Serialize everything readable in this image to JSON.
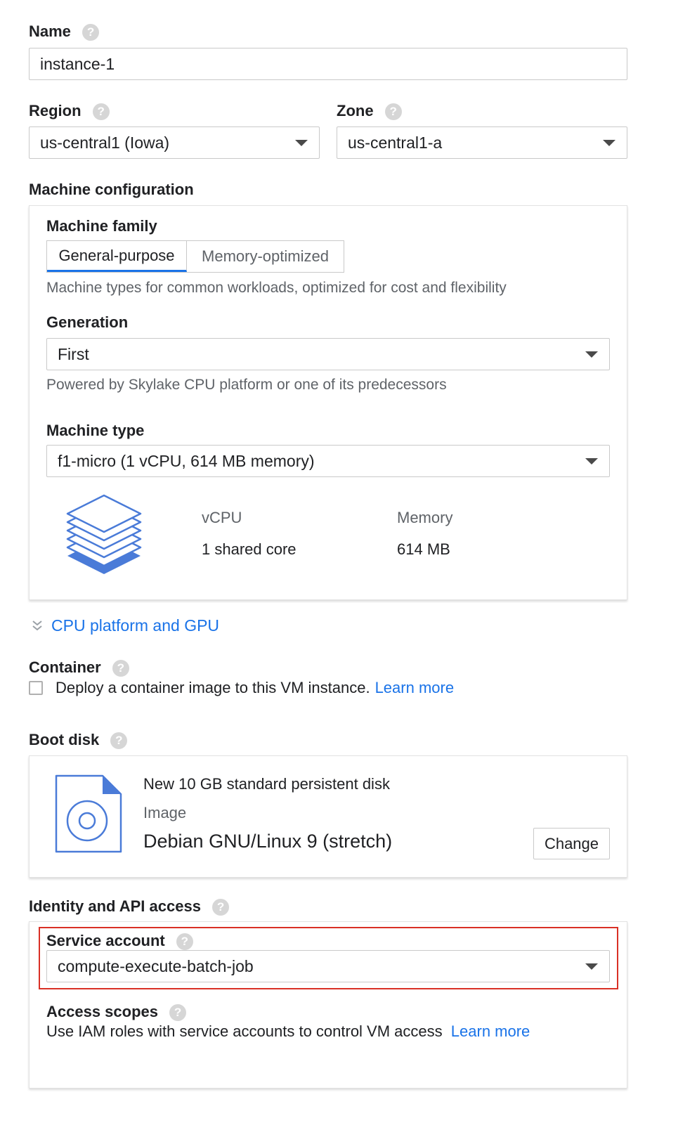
{
  "name": {
    "label": "Name",
    "value": "instance-1"
  },
  "region": {
    "label": "Region",
    "value": "us-central1 (Iowa)"
  },
  "zone": {
    "label": "Zone",
    "value": "us-central1-a"
  },
  "machine_config": {
    "heading": "Machine configuration",
    "family": {
      "label": "Machine family",
      "tabs": [
        "General-purpose",
        "Memory-optimized"
      ],
      "description": "Machine types for common workloads, optimized for cost and flexibility"
    },
    "generation": {
      "label": "Generation",
      "value": "First",
      "description": "Powered by Skylake CPU platform or one of its predecessors"
    },
    "machine_type": {
      "label": "Machine type",
      "value": "f1-micro (1 vCPU, 614 MB memory)"
    },
    "specs": {
      "vcpu_label": "vCPU",
      "vcpu_value": "1 shared core",
      "memory_label": "Memory",
      "memory_value": "614 MB"
    }
  },
  "cpu_gpu_link": "CPU platform and GPU",
  "container": {
    "label": "Container",
    "checkbox_text": "Deploy a container image to this VM instance.",
    "learn_more": "Learn more"
  },
  "boot_disk": {
    "label": "Boot disk",
    "title": "New 10 GB standard persistent disk",
    "image_label": "Image",
    "image_value": "Debian GNU/Linux 9 (stretch)",
    "change_button": "Change"
  },
  "identity": {
    "label": "Identity and API access",
    "service_account": {
      "label": "Service account",
      "value": "compute-execute-batch-job"
    },
    "access_scopes": {
      "label": "Access scopes",
      "description": "Use IAM roles with service accounts to control VM access",
      "learn_more": "Learn more"
    }
  },
  "help_glyph": "?",
  "colors": {
    "accent": "#1a73e8",
    "highlight": "#d93025",
    "icon_blue": "#4a7bd8"
  }
}
